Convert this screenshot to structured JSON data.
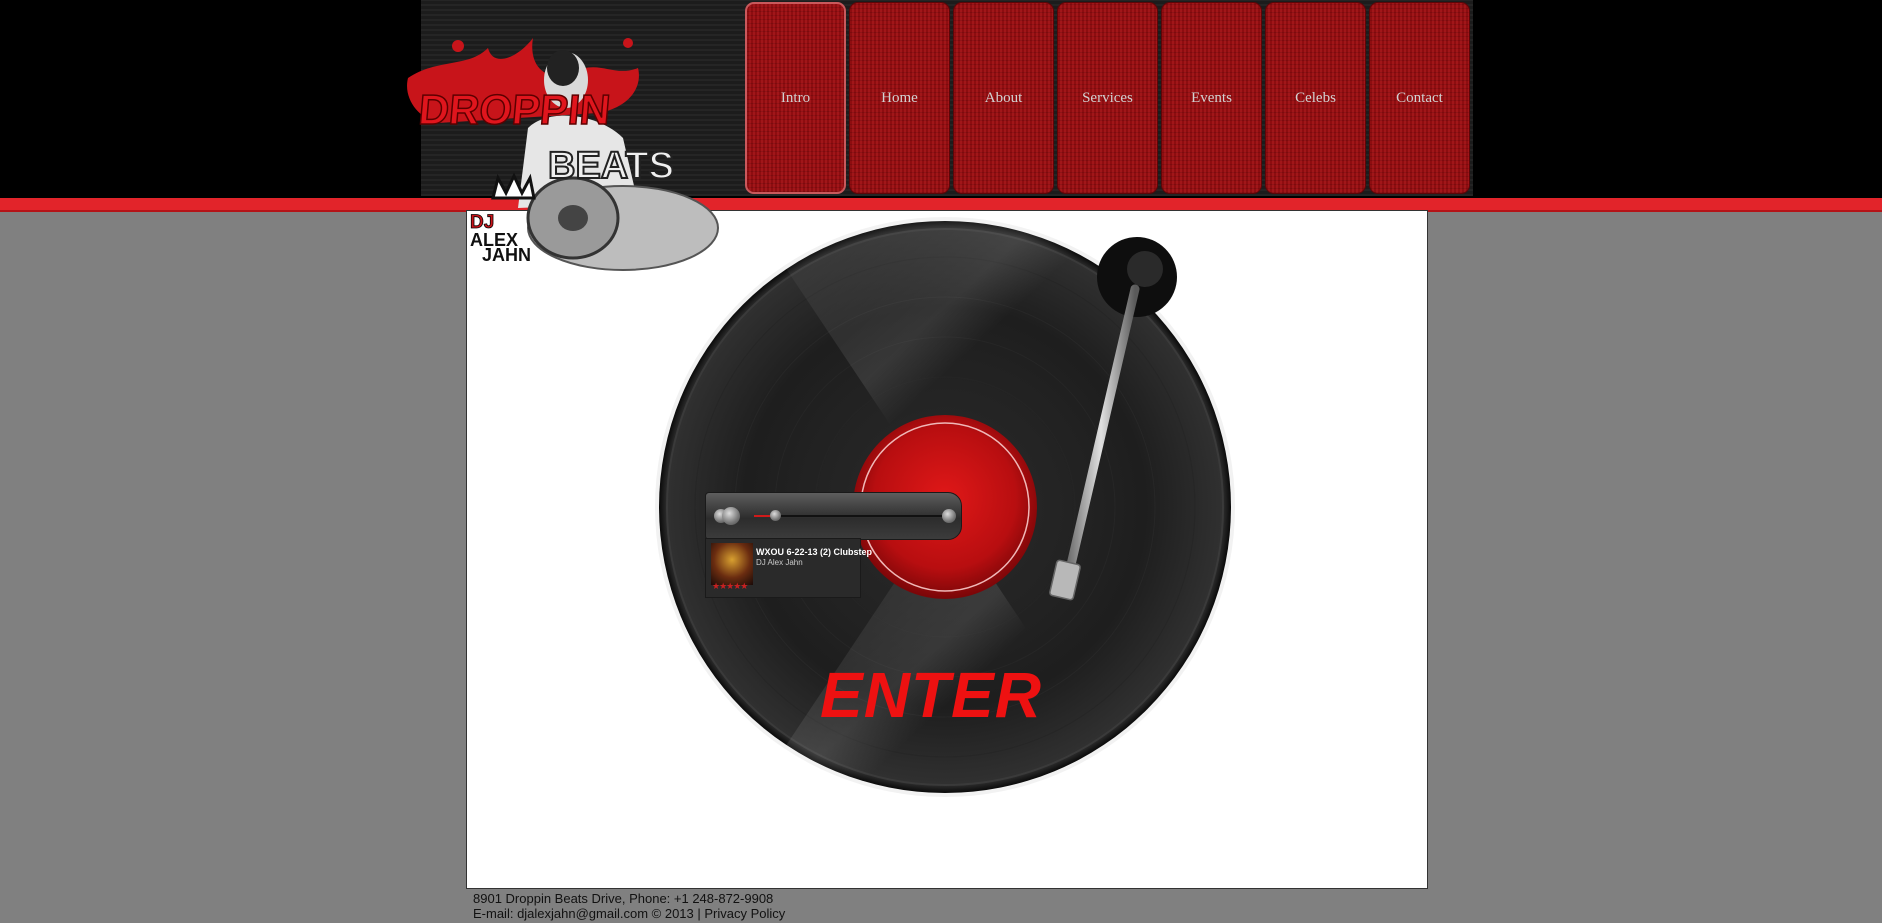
{
  "colors": {
    "page_background": "#808080",
    "header_background": "#000000",
    "accent_red": "#e2242a",
    "nav_red": "#9e0e12",
    "enter_red": "#ee1111"
  },
  "logo": {
    "brand_name": "Droppin Beats",
    "dj_name": "DJ Alex Jahn",
    "icon": "dj-logo-icon"
  },
  "nav": {
    "items": [
      {
        "label": "Intro",
        "active": true
      },
      {
        "label": "Home"
      },
      {
        "label": "About"
      },
      {
        "label": "Services"
      },
      {
        "label": "Events"
      },
      {
        "label": "Celebs"
      },
      {
        "label": "Contact"
      }
    ]
  },
  "player": {
    "track_title": "WXOU 6-22-13 (2) Clubstep",
    "artist": "DJ Alex Jahn",
    "rating_stars": "★★★★★",
    "progress": 0.13,
    "icons": [
      "play-icon",
      "volume-icon",
      "share-icon"
    ]
  },
  "main": {
    "enter_label": "ENTER",
    "turntable_icon": "turntable-icon"
  },
  "footer": {
    "address_line": "8901 Droppin Beats Drive, Phone: +1 248-872-9908",
    "email_prefix": "E-mail: ",
    "email": "djalexjahn@gmail.com",
    "copyright": " © 2013 | ",
    "privacy_label": "Privacy Policy"
  }
}
